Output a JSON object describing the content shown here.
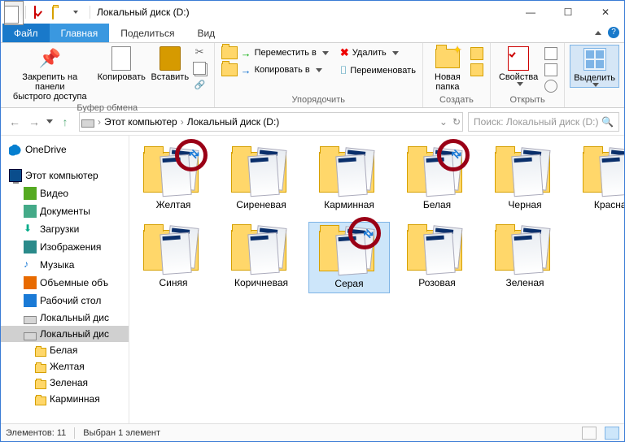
{
  "title": "Локальный диск (D:)",
  "tabs": {
    "file": "Файл",
    "home": "Главная",
    "share": "Поделиться",
    "view": "Вид"
  },
  "ribbon": {
    "clipboard": {
      "label": "Буфер обмена",
      "pin": "Закрепить на панели\nбыстрого доступа",
      "copy": "Копировать",
      "paste": "Вставить"
    },
    "organize": {
      "label": "Упорядочить",
      "move": "Переместить в",
      "copyto": "Копировать в",
      "delete": "Удалить",
      "rename": "Переименовать"
    },
    "create": {
      "label": "Создать",
      "newfolder": "Новая\nпапка"
    },
    "open": {
      "label": "Открыть",
      "props": "Свойства"
    },
    "select": {
      "label": "",
      "selectbtn": "Выделить"
    }
  },
  "breadcrumb": {
    "root": "Этот компьютер",
    "leaf": "Локальный диск (D:)"
  },
  "search": {
    "placeholder": "Поиск: Локальный диск (D:)"
  },
  "tree": {
    "onedrive": "OneDrive",
    "pc": "Этот компьютер",
    "video": "Видео",
    "docs": "Документы",
    "downloads": "Загрузки",
    "images": "Изображения",
    "music": "Музыка",
    "objects": "Объемные объ",
    "desktop": "Рабочий стол",
    "localc": "Локальный дис",
    "locald": "Локальный дис",
    "sub": [
      "Белая",
      "Желтая",
      "Зеленая",
      "Карминная"
    ]
  },
  "folders": [
    "Желтая",
    "Сиреневая",
    "Карминная",
    "Белая",
    "Черная",
    "Красная",
    "Синяя",
    "Коричневая",
    "Серая",
    "Розовая",
    "Зеленая"
  ],
  "status": {
    "count": "Элементов: 11",
    "selected": "Выбран 1 элемент"
  }
}
